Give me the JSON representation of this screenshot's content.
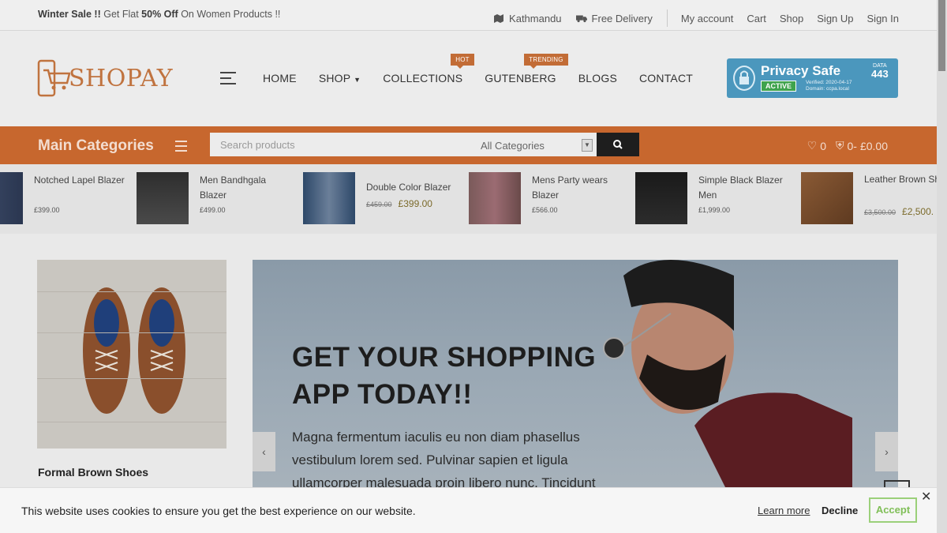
{
  "topbar": {
    "promo_bold1": "Winter Sale !!",
    "promo_text1": " Get Flat ",
    "promo_bold2": "50% Off",
    "promo_text2": " On Women Products !!",
    "location": "Kathmandu",
    "delivery": "Free Delivery",
    "links": [
      "My account",
      "Cart",
      "Shop",
      "Sign Up",
      "Sign In"
    ]
  },
  "header": {
    "logo_text": "SHOPAY",
    "nav": [
      {
        "label": "HOME",
        "badge": ""
      },
      {
        "label": "SHOP",
        "badge": ""
      },
      {
        "label": "COLLECTIONS",
        "badge": "HOT"
      },
      {
        "label": "GUTENBERG",
        "badge": "TRENDING"
      },
      {
        "label": "BLOGS",
        "badge": ""
      },
      {
        "label": "CONTACT",
        "badge": ""
      }
    ],
    "privacy": {
      "title": "Privacy Safe",
      "status": "ACTIVE",
      "verified": "Verified: 2020-04-17",
      "domain": "Domain: ccpa.local",
      "data_label": "DATA",
      "data_code": "443"
    }
  },
  "catbar": {
    "title": "Main Categories",
    "search_placeholder": "Search products",
    "category_select": "All Categories",
    "wishlist_count": "0",
    "cart_count": "0-",
    "cart_total": "£0.00"
  },
  "products": [
    {
      "name": "Notched Lapel Blazer",
      "old_price": "",
      "price": "£399.00"
    },
    {
      "name": "Men Bandhgala Blazer",
      "old_price": "",
      "price": "£499.00"
    },
    {
      "name": "Double Color Blazer",
      "old_price": "£459.00",
      "price": "£399.00"
    },
    {
      "name": "Mens Party wears Blazer",
      "old_price": "",
      "price": "£566.00"
    },
    {
      "name": "Simple Black Blazer Men",
      "old_price": "",
      "price": "£1,999.00"
    },
    {
      "name": "Leather Brown Shoes",
      "old_price": "£3,500.00",
      "price": "£2,500."
    }
  ],
  "side": {
    "label": "Formal Brown Shoes"
  },
  "hero": {
    "heading_line1": "GET YOUR SHOPPING",
    "heading_line2": "APP TODAY!!",
    "body": "Magna fermentum iaculis eu non diam phasellus vestibulum lorem sed. Pulvinar sapien et ligula ullamcorper malesuada proin libero nunc. Tincidunt"
  },
  "cookie": {
    "message": "This website uses cookies to ensure you get the best experience on our website.",
    "learn_more": "Learn more",
    "decline": "Decline",
    "accept": "Accept"
  },
  "colors": {
    "brand": "#c7672e",
    "accent_green": "#80bf58",
    "privacy_blue": "#4b97bd"
  }
}
